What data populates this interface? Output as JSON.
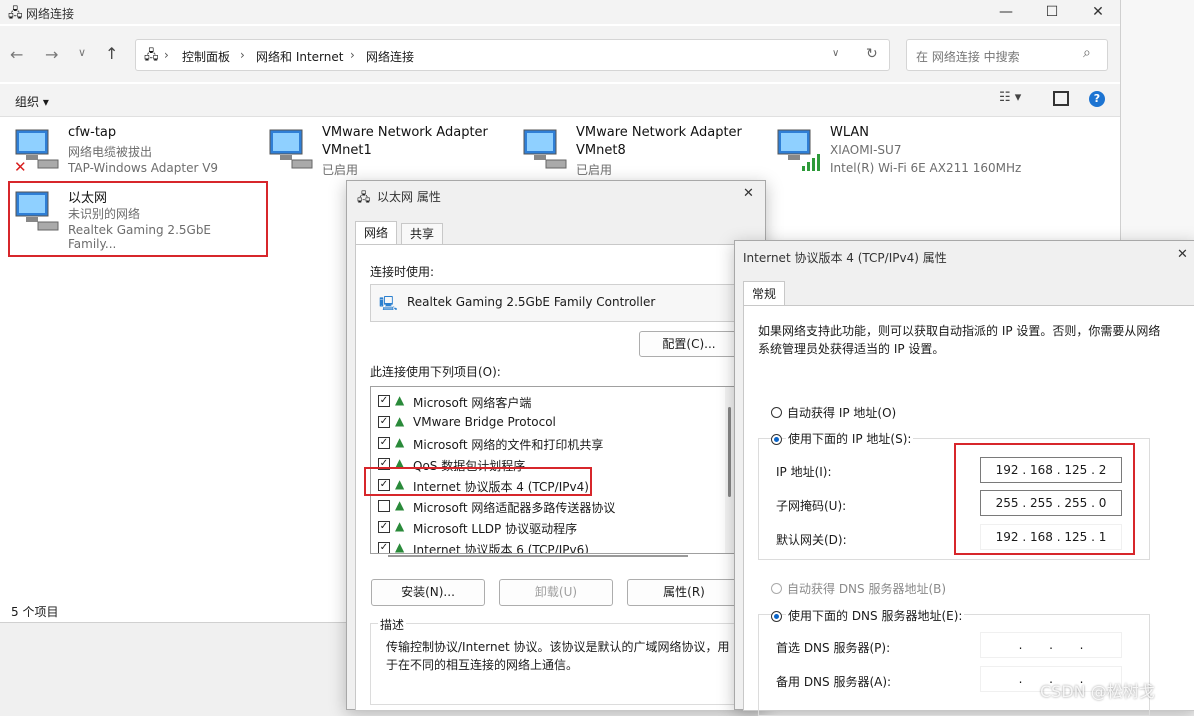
{
  "explorer": {
    "title": "网络连接",
    "window_controls": [
      "—",
      "☐",
      "✕"
    ],
    "breadcrumb": [
      "控制面板",
      "网络和 Internet",
      "网络连接"
    ],
    "search_placeholder": "在 网络连接 中搜索",
    "organize_label": "组织 ▾",
    "status_count": "5 个项目",
    "items": [
      {
        "title": "cfw-tap",
        "line1": "网络电缆被拔出",
        "line2": "TAP-Windows Adapter V9"
      },
      {
        "title": "VMware Network Adapter",
        "line1": "VMnet1",
        "line2": "已启用"
      },
      {
        "title": "VMware Network Adapter",
        "line1": "VMnet8",
        "line2": "已启用"
      },
      {
        "title": "WLAN",
        "line1": "XIAOMI-SU7",
        "line2": "Intel(R) Wi-Fi 6E AX211 160MHz"
      },
      {
        "title": "以太网",
        "line1": "未识别的网络",
        "line2": "Realtek Gaming 2.5GbE Family..."
      }
    ]
  },
  "eth_dialog": {
    "title": "以太网 属性",
    "tabs": [
      "网络",
      "共享"
    ],
    "connect_using_label": "连接时使用:",
    "adapter_name": "Realtek Gaming 2.5GbE Family Controller",
    "configure_button": "配置(C)...",
    "items_label": "此连接使用下列项目(O):",
    "components": [
      {
        "label": "Microsoft 网络客户端",
        "checked": true
      },
      {
        "label": "VMware Bridge Protocol",
        "checked": true
      },
      {
        "label": "Microsoft 网络的文件和打印机共享",
        "checked": true
      },
      {
        "label": "QoS 数据包计划程序",
        "checked": true
      },
      {
        "label": "Internet 协议版本 4 (TCP/IPv4)",
        "checked": true
      },
      {
        "label": "Microsoft 网络适配器多路传送器协议",
        "checked": false
      },
      {
        "label": "Microsoft LLDP 协议驱动程序",
        "checked": true
      },
      {
        "label": "Internet 协议版本 6 (TCP/IPv6)",
        "checked": true
      }
    ],
    "install_button": "安装(N)...",
    "uninstall_button": "卸载(U)",
    "properties_button": "属性(R)",
    "description_label": "描述",
    "description_text": "传输控制协议/Internet 协议。该协议是默认的广域网络协议，用于在不同的相互连接的网络上通信。"
  },
  "ipv4_dialog": {
    "title": "Internet 协议版本 4 (TCP/IPv4) 属性",
    "tab": "常规",
    "intro": "如果网络支持此功能，则可以获取自动指派的 IP 设置。否则，你需要从网络系统管理员处获得适当的 IP 设置。",
    "auto_ip_label": "自动获得 IP 地址(O)",
    "manual_ip_label": "使用下面的 IP 地址(S):",
    "ip_label": "IP 地址(I):",
    "ip_value": "192 . 168 . 125 .  2",
    "mask_label": "子网掩码(U):",
    "mask_value": "255 . 255 . 255 .  0",
    "gateway_label": "默认网关(D):",
    "gateway_value": "192 . 168 . 125 .  1",
    "auto_dns_label": "自动获得 DNS 服务器地址(B)",
    "manual_dns_label": "使用下面的 DNS 服务器地址(E):",
    "preferred_dns_label": "首选 DNS 服务器(P):",
    "preferred_dns_value": ".       .       .",
    "alternate_dns_label": "备用 DNS 服务器(A):",
    "alternate_dns_value": ".       .       ."
  },
  "watermark": "CSDN @松树戈",
  "colors": {
    "highlight_red": "#d7262b",
    "radio_blue": "#0a64c8"
  }
}
